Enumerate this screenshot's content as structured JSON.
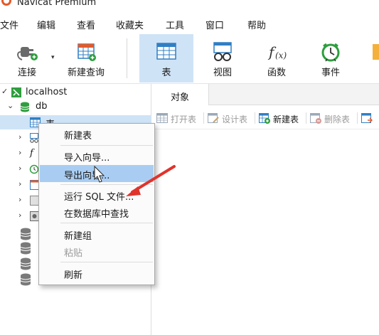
{
  "window": {
    "title": "Navicat Premium"
  },
  "menubar": {
    "items": [
      "文件",
      "编辑",
      "查看",
      "收藏夹",
      "工具",
      "窗口",
      "帮助"
    ]
  },
  "toolbar": {
    "connect": "连接",
    "new_query": "新建查询",
    "table": "表",
    "view": "视图",
    "function": "函数",
    "event": "事件"
  },
  "nav": {
    "connection": "localhost",
    "database": "db",
    "selected_node": "表"
  },
  "tabs": {
    "objects": "对象"
  },
  "object_toolbar": {
    "open": "打开表",
    "design": "设计表",
    "new": "新建表",
    "delete": "删除表"
  },
  "context_menu": {
    "items": [
      "新建表",
      "导入向导...",
      "导出向导...",
      "运行 SQL 文件...",
      "在数据库中查找",
      "新建组",
      "粘贴",
      "刷新"
    ]
  },
  "colors": {
    "selection": "#cfe3f7",
    "menu_highlight": "#a9cdf2",
    "annotation_arrow": "#e0332d",
    "db_icon": "#2e9e3e"
  }
}
